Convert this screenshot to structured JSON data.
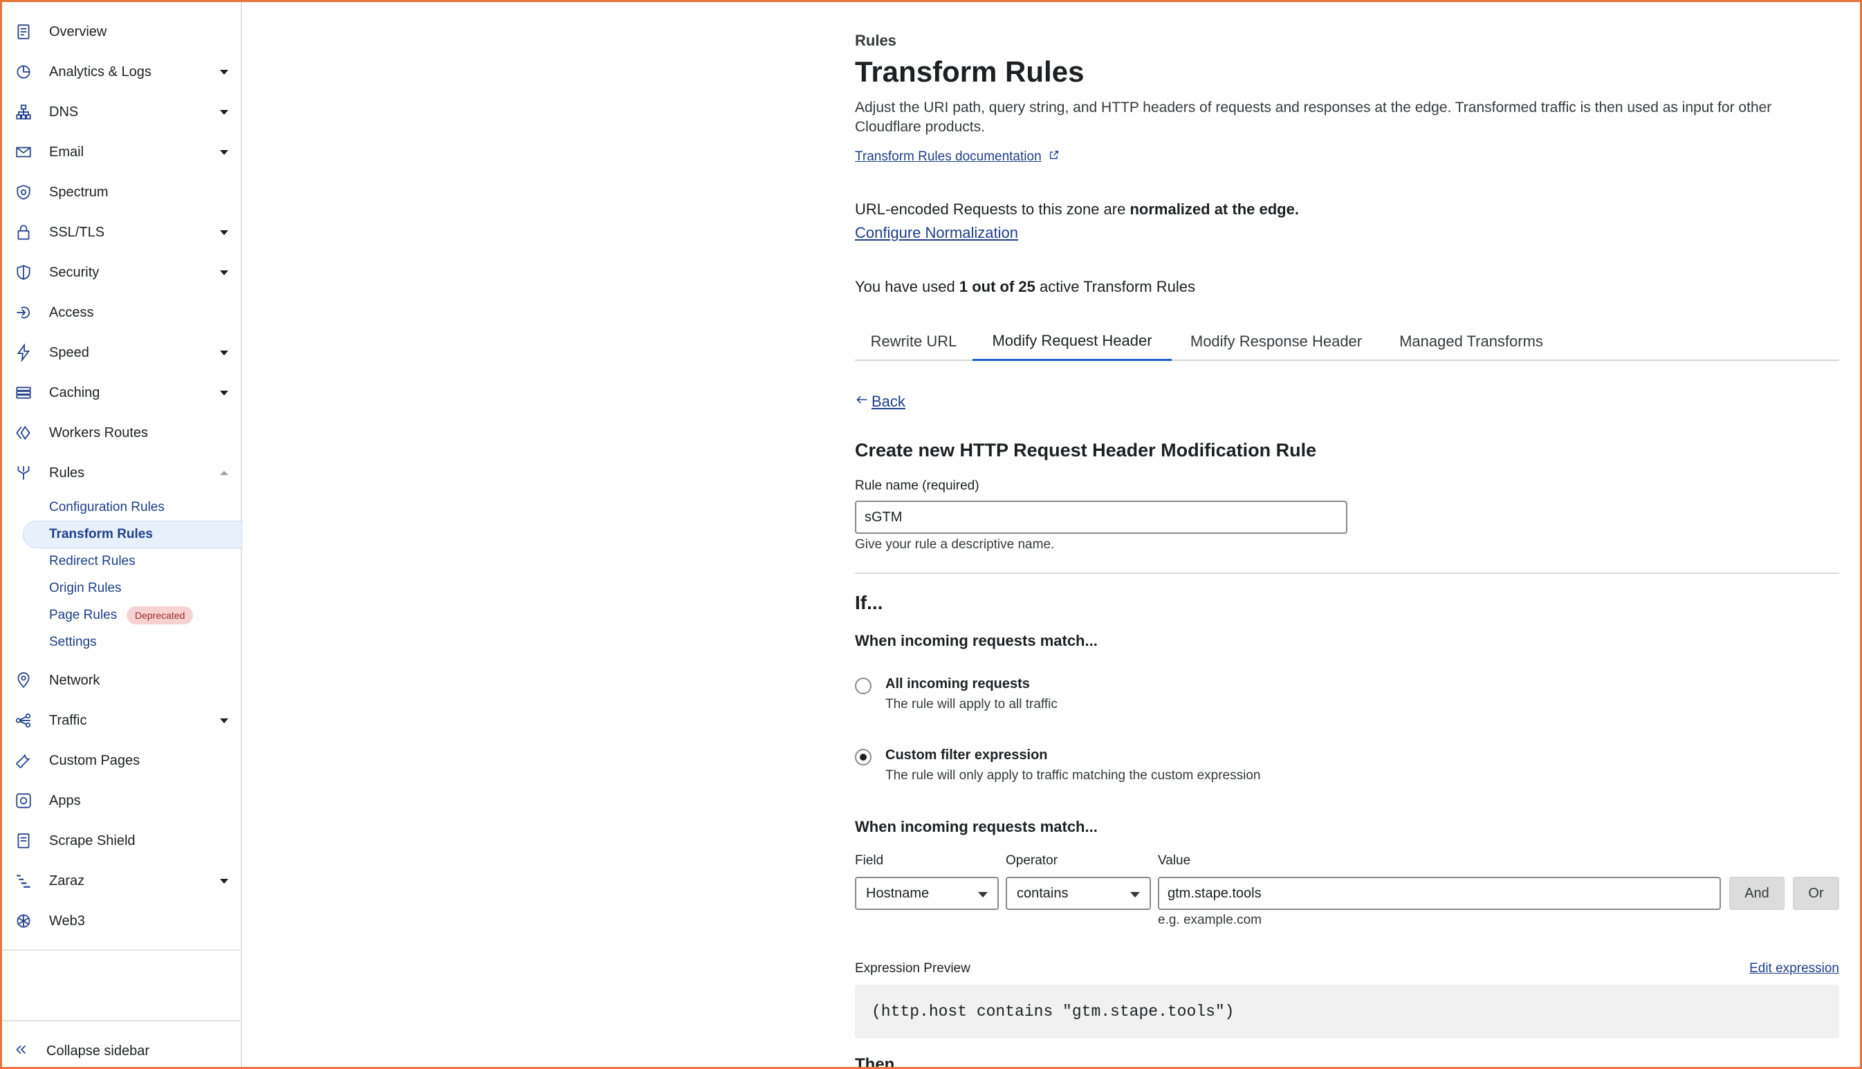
{
  "sidebar": {
    "items": [
      {
        "label": "Overview",
        "icon": "document-icon",
        "expandable": false
      },
      {
        "label": "Analytics & Logs",
        "icon": "pie-chart-icon",
        "expandable": true
      },
      {
        "label": "DNS",
        "icon": "sitemap-icon",
        "expandable": true
      },
      {
        "label": "Email",
        "icon": "envelope-icon",
        "expandable": true
      },
      {
        "label": "Spectrum",
        "icon": "shield-gear-icon",
        "expandable": false
      },
      {
        "label": "SSL/TLS",
        "icon": "lock-icon",
        "expandable": true
      },
      {
        "label": "Security",
        "icon": "shield-icon",
        "expandable": true
      },
      {
        "label": "Access",
        "icon": "access-arrow-icon",
        "expandable": false
      },
      {
        "label": "Speed",
        "icon": "lightning-icon",
        "expandable": true
      },
      {
        "label": "Caching",
        "icon": "server-stack-icon",
        "expandable": true
      },
      {
        "label": "Workers Routes",
        "icon": "workers-icon",
        "expandable": false
      },
      {
        "label": "Rules",
        "icon": "fork-icon",
        "expandable": true,
        "expanded": true
      }
    ],
    "rules_sub": [
      {
        "label": "Configuration Rules",
        "active": false
      },
      {
        "label": "Transform Rules",
        "active": true
      },
      {
        "label": "Redirect Rules",
        "active": false
      },
      {
        "label": "Origin Rules",
        "active": false
      },
      {
        "label": "Page Rules",
        "active": false,
        "badge": "Deprecated"
      },
      {
        "label": "Settings",
        "active": false
      }
    ],
    "items_after": [
      {
        "label": "Network",
        "icon": "location-pin-icon",
        "expandable": false
      },
      {
        "label": "Traffic",
        "icon": "share-nodes-icon",
        "expandable": true
      },
      {
        "label": "Custom Pages",
        "icon": "wrench-icon",
        "expandable": false
      },
      {
        "label": "Apps",
        "icon": "apps-icon",
        "expandable": false
      },
      {
        "label": "Scrape Shield",
        "icon": "page-shield-icon",
        "expandable": false
      },
      {
        "label": "Zaraz",
        "icon": "zaraz-icon",
        "expandable": true
      },
      {
        "label": "Web3",
        "icon": "web3-icon",
        "expandable": false
      }
    ],
    "collapse_label": "Collapse sidebar"
  },
  "main": {
    "kicker": "Rules",
    "title": "Transform Rules",
    "description": "Adjust the URI path, query string, and HTTP headers of requests and responses at the edge. Transformed traffic is then used as input for other Cloudflare products.",
    "doc_link": "Transform Rules documentation",
    "normalization_prefix": "URL-encoded Requests to this zone are ",
    "normalization_bold": "normalized at the edge.",
    "normalization_link": "Configure Normalization",
    "usage_prefix": "You have used ",
    "usage_bold": "1 out of 25",
    "usage_suffix": " active Transform Rules",
    "tabs": [
      {
        "label": "Rewrite URL",
        "active": false
      },
      {
        "label": "Modify Request Header",
        "active": true
      },
      {
        "label": "Modify Response Header",
        "active": false
      },
      {
        "label": "Managed Transforms",
        "active": false
      }
    ],
    "back_label": "Back",
    "form_title": "Create new HTTP Request Header Modification Rule",
    "rule_name_label": "Rule name (required)",
    "rule_name_value": "sGTM",
    "rule_name_hint": "Give your rule a descriptive name.",
    "if_heading": "If...",
    "match_heading": "When incoming requests match...",
    "radio_options": [
      {
        "title": "All incoming requests",
        "desc": "The rule will apply to all traffic",
        "checked": false
      },
      {
        "title": "Custom filter expression",
        "desc": "The rule will only apply to traffic matching the custom expression",
        "checked": true
      }
    ],
    "match_heading_2": "When incoming requests match...",
    "field_label": "Field",
    "field_value": "Hostname",
    "operator_label": "Operator",
    "operator_value": "contains",
    "value_label": "Value",
    "value_value": "gtm.stape.tools",
    "value_hint": "e.g. example.com",
    "and_label": "And",
    "or_label": "Or",
    "preview_label": "Expression Preview",
    "edit_expression": "Edit expression",
    "expression": "(http.host contains \"gtm.stape.tools\")",
    "then_heading": "Then..."
  }
}
